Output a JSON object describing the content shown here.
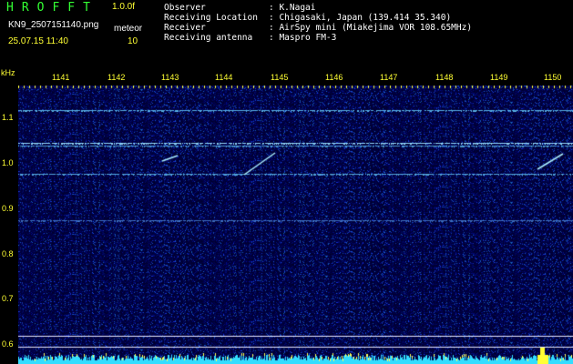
{
  "header": {
    "app_title": "HROFFT",
    "version": "1.0.0f",
    "filename": "KN9_2507151140.png",
    "timestamp": "25.07.15 11:40",
    "mode_label": "meteor",
    "mode_value": "10"
  },
  "info": [
    {
      "key": "Observer",
      "value": ": K.Nagai"
    },
    {
      "key": "Receiving Location",
      "value": ": Chigasaki, Japan (139.414 35.340)"
    },
    {
      "key": "Receiver",
      "value": ": AirSpy mini (Miakejima VOR 108.65MHz)"
    },
    {
      "key": "Receiving antenna",
      "value": ": Maspro FM-3"
    }
  ],
  "axes": {
    "y_unit": "kHz",
    "x_ticks": [
      "1141",
      "1142",
      "1143",
      "1144",
      "1145",
      "1146",
      "1147",
      "1148",
      "1149",
      "1150"
    ],
    "y_ticks": [
      "1.1",
      "1.0",
      "0.9",
      "0.8",
      "0.7",
      "0.6"
    ]
  },
  "colors": {
    "label_yellow": "#ffff33",
    "title_green": "#33ff33",
    "background": "#00003a",
    "signal_cyan": "#66ccff"
  }
}
